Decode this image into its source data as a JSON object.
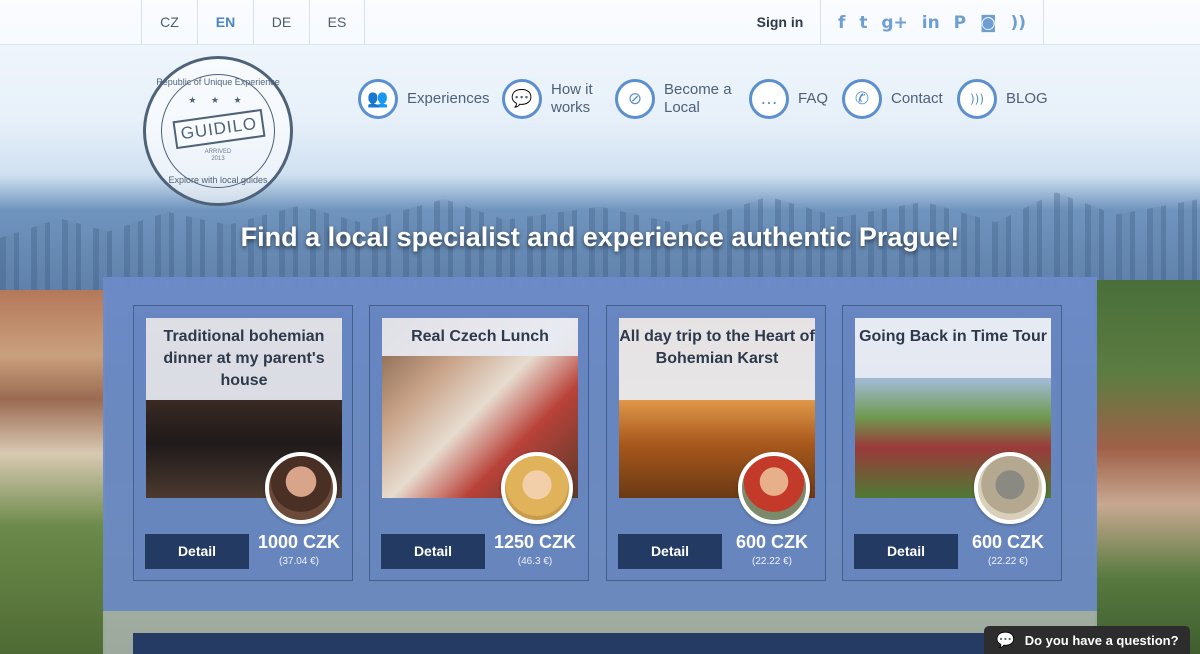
{
  "languages": [
    {
      "code": "CZ",
      "active": false
    },
    {
      "code": "EN",
      "active": true
    },
    {
      "code": "DE",
      "active": false
    },
    {
      "code": "ES",
      "active": false
    }
  ],
  "header": {
    "signin_label": "Sign in",
    "social_icons": [
      "facebook-icon",
      "twitter-icon",
      "google-plus-icon",
      "linkedin-icon",
      "pinterest-icon",
      "instagram-icon",
      "rss-icon"
    ],
    "social_glyphs": [
      "f",
      "t",
      "g+",
      "in",
      "P",
      "◙",
      "))"
    ]
  },
  "logo": {
    "name": "GUIDILO",
    "ring_top": "Republic of Unique Experience",
    "ring_bottom": "Explore with local guides",
    "stars": "★ ★ ★",
    "arrived": "ARRIVED",
    "year": "2013"
  },
  "nav": [
    {
      "label": "Experiences",
      "icon": "people-icon",
      "glyph": "👥"
    },
    {
      "label": "How it works",
      "icon": "chat-bubble-icon",
      "glyph": "💬"
    },
    {
      "label": "Become a Local",
      "icon": "compass-icon",
      "glyph": "⊘"
    },
    {
      "label": "FAQ",
      "icon": "faq-bubbles-icon",
      "glyph": "…"
    },
    {
      "label": "Contact",
      "icon": "phone-icon",
      "glyph": "✆"
    },
    {
      "label": "BLOG",
      "icon": "rss-icon",
      "glyph": ")))"
    }
  ],
  "headline": "Find a local specialist and experience authentic Prague!",
  "cards": [
    {
      "title": "Traditional bohemian dinner at my parent's house",
      "detail_label": "Detail",
      "price": "1000 CZK",
      "price_eur": "(37.04 €)"
    },
    {
      "title": "Real Czech Lunch",
      "detail_label": "Detail",
      "price": "1250 CZK",
      "price_eur": "(46.3 €)"
    },
    {
      "title": "All day trip to the Heart of Bohemian Karst",
      "detail_label": "Detail",
      "price": "600 CZK",
      "price_eur": "(22.22 €)"
    },
    {
      "title": "Going Back in Time Tour",
      "detail_label": "Detail",
      "price": "600 CZK",
      "price_eur": "(22.22 €)"
    }
  ],
  "chat": {
    "label": "Do you have a question?",
    "icon_glyph": "💬"
  }
}
